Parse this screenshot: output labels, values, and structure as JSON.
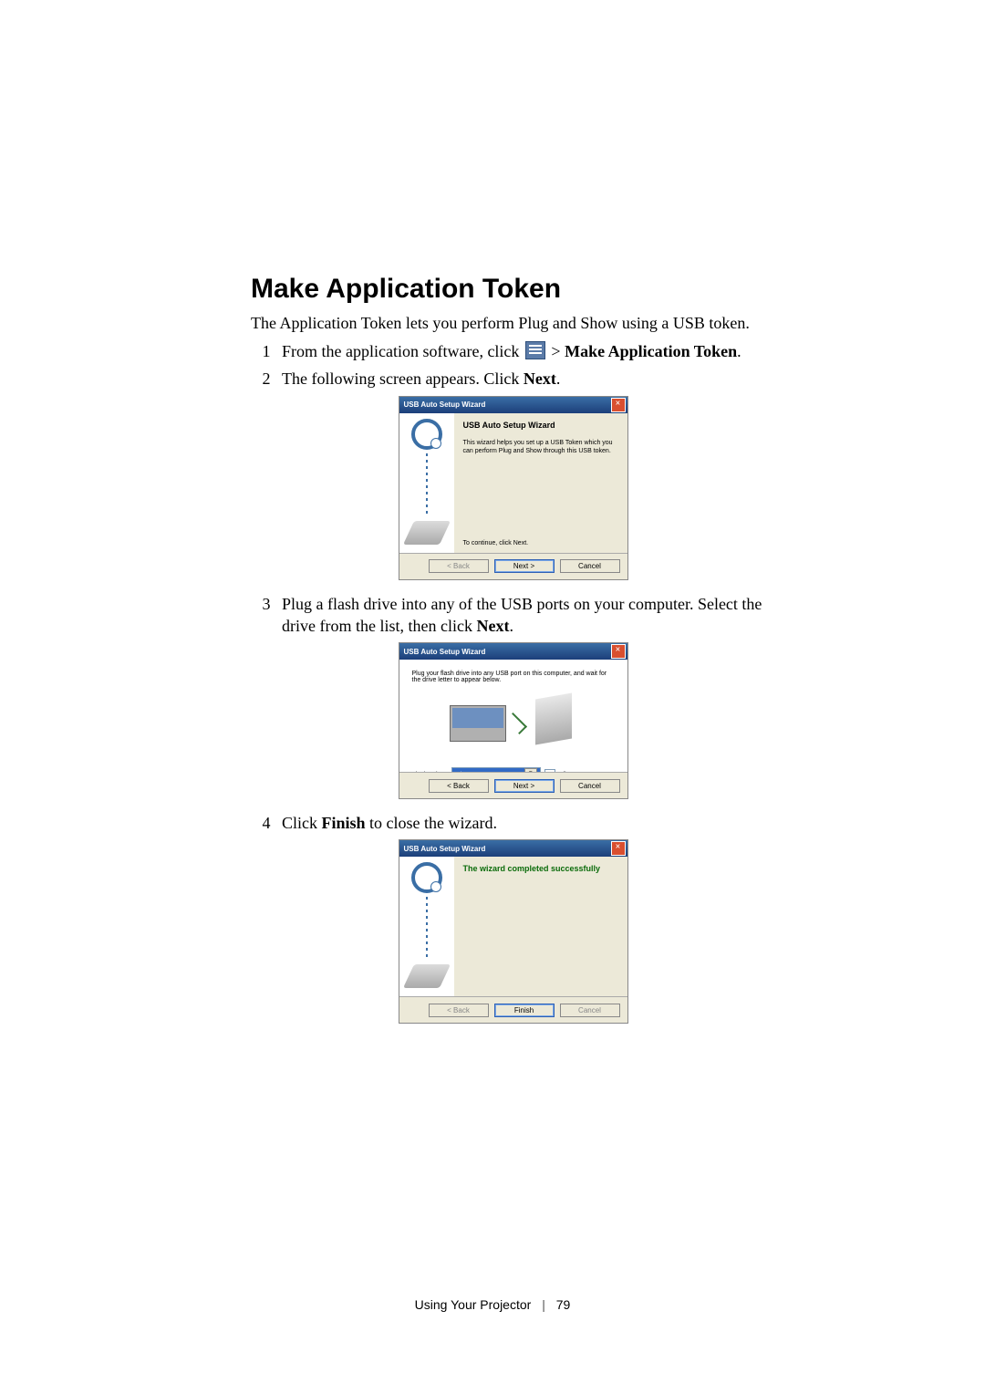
{
  "heading": "Make Application Token",
  "intro": "The Application Token lets you perform Plug and Show using a USB token.",
  "steps": {
    "s1_pre": "From the application software, click ",
    "s1_post": " > ",
    "s1_bold": "Make Application Token",
    "s1_tail": ".",
    "s2_pre": "The following screen appears. Click ",
    "s2_bold": "Next",
    "s2_tail": ".",
    "s3_pre": "Plug a flash drive into any of the USB ports on your computer. Select the drive from the list, then click ",
    "s3_bold": "Next",
    "s3_tail": ".",
    "s4_pre": "Click ",
    "s4_bold": "Finish",
    "s4_tail": " to close the wizard."
  },
  "wizard": {
    "title": "USB Auto Setup Wizard",
    "close_glyph": "×",
    "s1": {
      "heading": "USB Auto Setup Wizard",
      "desc": "This wizard helps you set up a USB Token which you can perform Plug and Show through this USB token.",
      "continue": "To continue, click Next.",
      "back": "< Back",
      "next": "Next >",
      "cancel": "Cancel"
    },
    "s2": {
      "desc": "Plug your flash drive into any USB port on this computer, and wait for the drive letter to appear below.",
      "flash_label": "Flash Drive :",
      "flash_value": "F:\\",
      "dd_glyph": "▾",
      "all_label": "All",
      "back": "< Back",
      "next": "Next >",
      "cancel": "Cancel"
    },
    "s3": {
      "heading": "The wizard completed successfully",
      "back": "< Back",
      "finish": "Finish",
      "cancel": "Cancel"
    }
  },
  "footer": {
    "section": "Using Your Projector",
    "page": "79"
  }
}
